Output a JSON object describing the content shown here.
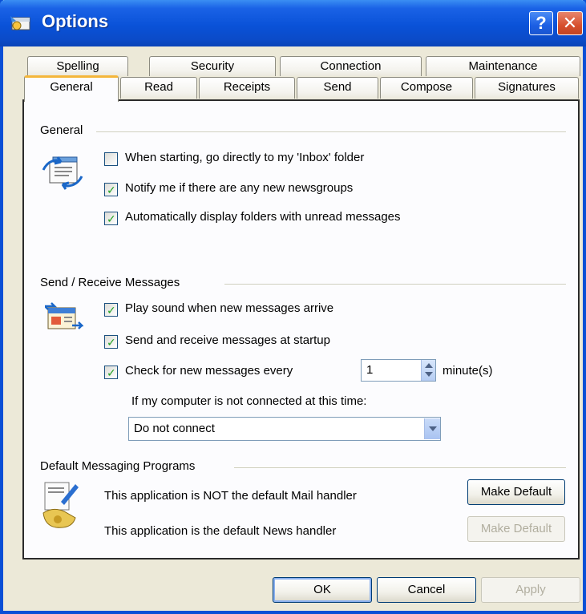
{
  "window": {
    "title": "Options"
  },
  "tabs": {
    "back_row": [
      "Spelling",
      "Security",
      "Connection",
      "Maintenance"
    ],
    "front_row": [
      "General",
      "Read",
      "Receipts",
      "Send",
      "Compose",
      "Signatures"
    ],
    "active": "General"
  },
  "general": {
    "heading": "General",
    "options": [
      {
        "label": "When starting, go directly to my 'Inbox' folder",
        "checked": false
      },
      {
        "label": "Notify me if there are any new newsgroups",
        "checked": true
      },
      {
        "label": "Automatically display folders with unread messages",
        "checked": true
      }
    ]
  },
  "send_receive": {
    "heading": "Send / Receive Messages",
    "options": [
      {
        "label": "Play sound when new messages arrive",
        "checked": true
      },
      {
        "label": "Send and receive messages at startup",
        "checked": true
      },
      {
        "label": "Check for new messages every",
        "checked": true
      }
    ],
    "interval_value": "1",
    "interval_unit": "minute(s)",
    "not_connected_label": "If my computer is not connected at this time:",
    "connect_option": "Do not connect"
  },
  "default_programs": {
    "heading": "Default Messaging Programs",
    "mail_status": "This application is NOT the default Mail handler",
    "news_status": "This application is the default News handler",
    "mail_button": "Make Default",
    "news_button": "Make Default"
  },
  "buttons": {
    "ok": "OK",
    "cancel": "Cancel",
    "apply": "Apply"
  },
  "colors": {
    "titlebar": "#0a52d8",
    "dialog_bg": "#ece9d8",
    "check_mark": "#21a121"
  }
}
